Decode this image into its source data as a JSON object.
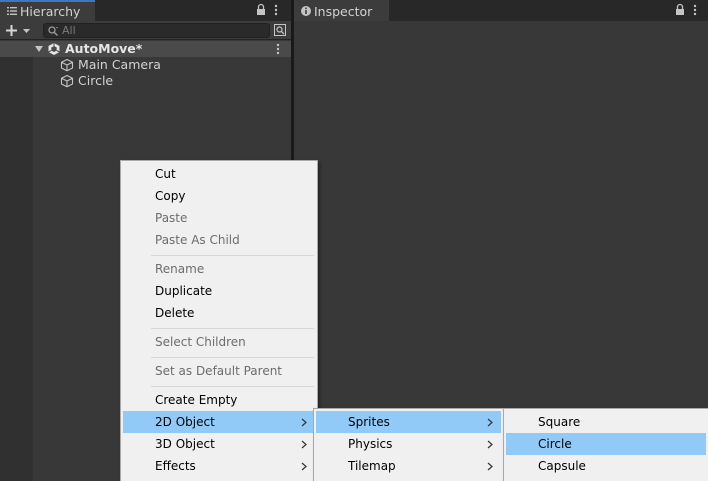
{
  "hierarchy": {
    "tab_title": "Hierarchy",
    "search": {
      "placeholder": "All",
      "value": ""
    },
    "scene": {
      "name": "AutoMove*"
    },
    "objects": [
      {
        "name": "Main Camera"
      },
      {
        "name": "Circle"
      }
    ]
  },
  "inspector": {
    "tab_title": "Inspector"
  },
  "context_menu": {
    "items": {
      "cut": "Cut",
      "copy": "Copy",
      "paste": "Paste",
      "paste_as_child": "Paste As Child",
      "rename": "Rename",
      "duplicate": "Duplicate",
      "delete": "Delete",
      "select_children": "Select Children",
      "set_default_parent": "Set as Default Parent",
      "create_empty": "Create Empty",
      "object_2d": "2D Object",
      "object_3d": "3D Object",
      "effects": "Effects"
    },
    "disabled": [
      "Paste",
      "Paste As Child",
      "Rename",
      "Select Children",
      "Set as Default Parent"
    ],
    "highlighted": "2D Object"
  },
  "submenu_2d": {
    "items": {
      "sprites": "Sprites",
      "physics": "Physics",
      "tilemap": "Tilemap"
    },
    "highlighted": "Sprites"
  },
  "submenu_sprites": {
    "items": {
      "square": "Square",
      "circle": "Circle",
      "capsule": "Capsule"
    },
    "highlighted": "Circle"
  },
  "colors": {
    "panel": "#383838",
    "tab_accent": "#3a79bb",
    "menu_bg": "#f0f0f0",
    "menu_highlight": "#91c9f7",
    "disabled_text": "#6d6d6d"
  }
}
